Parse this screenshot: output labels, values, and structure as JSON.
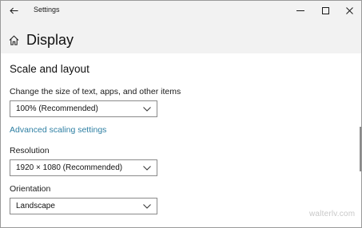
{
  "window": {
    "title": "Settings",
    "controls": {
      "minimize_icon": "minimize-icon",
      "maximize_icon": "maximize-icon",
      "close_icon": "close-icon"
    }
  },
  "header": {
    "back_icon": "back-arrow-icon",
    "home_icon": "home-icon",
    "title": "Display"
  },
  "section": {
    "title": "Scale and layout"
  },
  "scale": {
    "label": "Change the size of text, apps, and other items",
    "value": "100% (Recommended)"
  },
  "advanced_link": "Advanced scaling settings",
  "resolution": {
    "label": "Resolution",
    "value": "1920 × 1080 (Recommended)"
  },
  "orientation": {
    "label": "Orientation",
    "value": "Landscape"
  },
  "watermark": "walterlv.com",
  "colors": {
    "link": "#2e7fa3",
    "header_bg": "#f2f2f2"
  }
}
